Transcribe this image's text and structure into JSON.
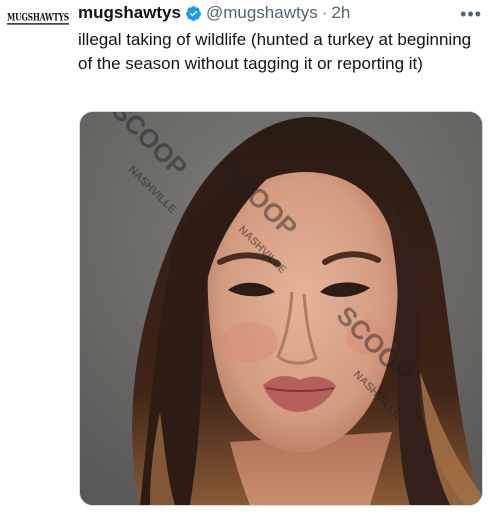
{
  "tweet": {
    "avatar_text": "MUGSHAWTYS",
    "display_name": "mugshawtys",
    "handle": "@mugshawtys",
    "separator": "·",
    "timestamp": "2h",
    "more_label": "•••",
    "body": "illegal taking of wildlife (hunted a turkey at beginning of the season without tagging it or reporting it)"
  },
  "media": {
    "watermark_main": "SCOOP",
    "watermark_sub": "NASHVILLE"
  },
  "colors": {
    "verified_badge": "#1d9bf0",
    "secondary_text": "#536471"
  },
  "icons": [
    "verified-badge-icon",
    "more-options-icon"
  ]
}
